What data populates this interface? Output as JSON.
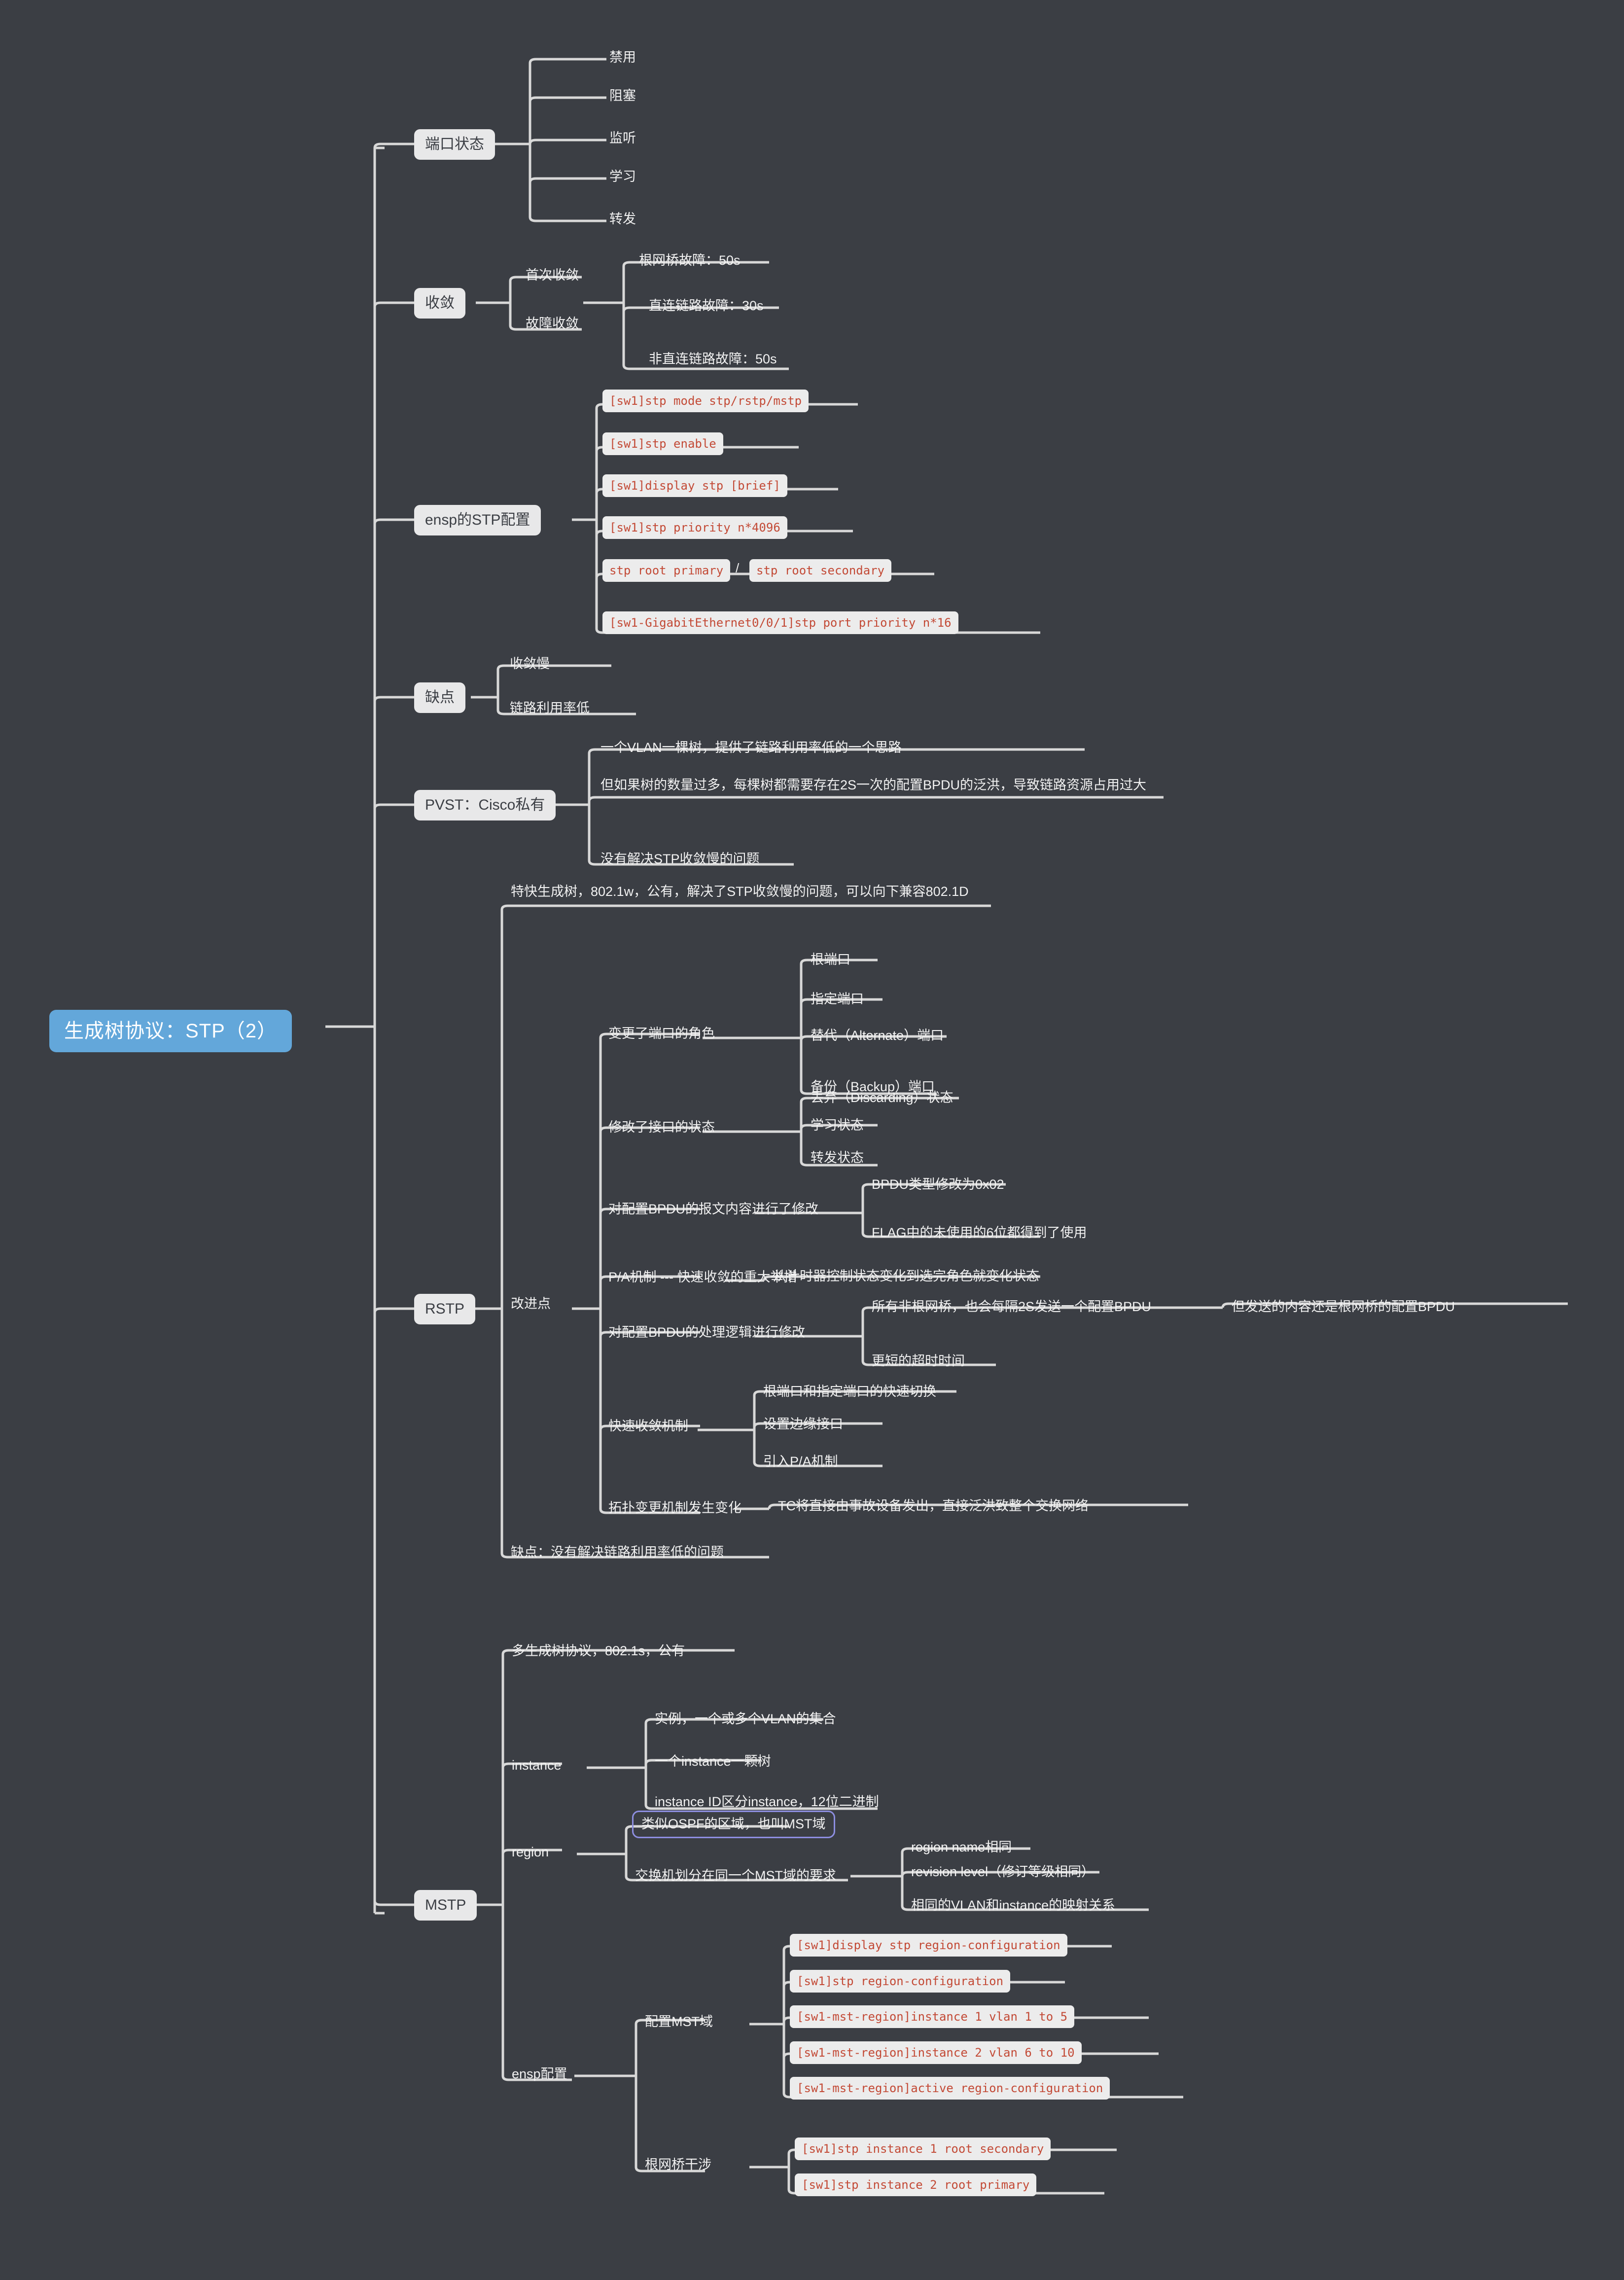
{
  "theme": {
    "background": "#3b3e44",
    "root_fill": "#63a7da",
    "root_text": "#ffffff",
    "chip_fill": "#e8e8e9",
    "chip_text": "#3b3e44",
    "text_color": "#f2f2f2",
    "code_fill": "#ececec",
    "code_text": "#c34a36",
    "outline_color": "#8d8ee0",
    "wire_color": "#d8d8d8"
  },
  "root": {
    "label": "生成树协议：STP（2）"
  },
  "branches": {
    "port_state": {
      "label": "端口状态",
      "children": [
        {
          "label": "禁用"
        },
        {
          "label": "阻塞"
        },
        {
          "label": "监听"
        },
        {
          "label": "学习"
        },
        {
          "label": "转发"
        }
      ]
    },
    "convergence": {
      "label": "收敛",
      "children": [
        {
          "label": "首次收敛"
        },
        {
          "label": "故障收敛",
          "children": [
            {
              "label": "根网桥故障：50s"
            },
            {
              "label": "直连链路故障：30s"
            },
            {
              "label": "非直连链路故障：50s"
            }
          ]
        }
      ]
    },
    "ensp_stp_config": {
      "label": "ensp的STP配置",
      "children": [
        {
          "label": "[sw1]stp mode stp/rstp/mstp"
        },
        {
          "label": "[sw1]stp enable"
        },
        {
          "label": "[sw1]display stp [brief]"
        },
        {
          "label": "[sw1]stp priority n*4096"
        },
        {
          "label": "stp root primary",
          "separator": "/",
          "label2": "stp root secondary"
        },
        {
          "label": "[sw1-GigabitEthernet0/0/1]stp port priority n*16"
        }
      ]
    },
    "drawbacks": {
      "label": "缺点",
      "children": [
        {
          "label": "收敛慢"
        },
        {
          "label": "链路利用率低"
        }
      ]
    },
    "pvst": {
      "label": "PVST：Cisco私有",
      "children": [
        {
          "label": "一个VLAN一棵树，提供了链路利用率低的一个思路"
        },
        {
          "label": "但如果树的数量过多，每棵树都需要存在2S一次的配置BPDU的泛洪，导致链路资源占用过大"
        },
        {
          "label": "没有解决STP收敛慢的问题"
        }
      ]
    },
    "rstp": {
      "label": "RSTP",
      "intro": "特快生成树，802.1w，公有，解决了STP收敛慢的问题，可以向下兼容802.1D",
      "improvements_label": "改进点",
      "improvements": [
        {
          "label": "变更了端口的角色",
          "children": [
            {
              "label": "根端口"
            },
            {
              "label": "指定端口"
            },
            {
              "label": "替代（Alternate）端口"
            },
            {
              "label": "备份（Backup）端口"
            }
          ]
        },
        {
          "label": "修改了接口的状态",
          "children": [
            {
              "label": "丢弃（Discarding）状态"
            },
            {
              "label": "学习状态"
            },
            {
              "label": "转发状态"
            }
          ]
        },
        {
          "label": "对配置BPDU的报文内容进行了修改",
          "children": [
            {
              "label": "BPDU类型修改为0x02"
            },
            {
              "label": "FLAG中的未使用的6位都得到了使用"
            }
          ]
        },
        {
          "label": "P/A机制 --- 快速收敛的重大举措",
          "children": [
            {
              "label": "从计时器控制状态变化到选完角色就变化状态"
            }
          ]
        },
        {
          "label": "对配置BPDU的处理逻辑进行修改",
          "children": [
            {
              "label": "所有非根网桥，也会每隔2S发送一个配置BPDU",
              "note": "但发送的内容还是根网桥的配置BPDU"
            },
            {
              "label": "更短的超时时间"
            }
          ]
        },
        {
          "label": "快速收敛机制",
          "children": [
            {
              "label": "根端口和指定端口的快速切换"
            },
            {
              "label": "设置边缘接口"
            },
            {
              "label": "引入P/A机制"
            }
          ]
        },
        {
          "label": "拓扑变更机制发生变化",
          "children": [
            {
              "label": "TC将直接由事故设备发出，直接泛洪致整个交换网络"
            }
          ]
        }
      ],
      "drawback": "缺点：没有解决链路利用率低的问题"
    },
    "mstp": {
      "label": "MSTP",
      "intro": "多生成树协议，802.1s，公有",
      "children": [
        {
          "label": "instance",
          "children": [
            {
              "label": "实例，一个或多个VLAN的集合"
            },
            {
              "label": "一个instance一颗树"
            },
            {
              "label": "instance ID区分instance，12位二进制"
            }
          ]
        },
        {
          "label": "region",
          "children": [
            {
              "label": "类似OSPF的区域，也叫MST域",
              "highlighted": true
            },
            {
              "label": "交换机划分在同一个MST域的要求",
              "children": [
                {
                  "label": "region name相同"
                },
                {
                  "label": "revision level（修订等级相同）"
                },
                {
                  "label": "相同的VLAN和instance的映射关系"
                }
              ]
            }
          ]
        },
        {
          "label": "ensp配置",
          "children": [
            {
              "label": "配置MST域",
              "children": [
                {
                  "label": "[sw1]display stp region-configuration"
                },
                {
                  "label": "[sw1]stp region-configuration"
                },
                {
                  "label": "[sw1-mst-region]instance 1 vlan 1 to 5"
                },
                {
                  "label": "[sw1-mst-region]instance 2 vlan 6 to 10"
                },
                {
                  "label": "[sw1-mst-region]active region-configuration"
                }
              ]
            },
            {
              "label": "根网桥干涉",
              "children": [
                {
                  "label": "[sw1]stp instance 1 root secondary"
                },
                {
                  "label": "[sw1]stp instance 2 root primary"
                }
              ]
            }
          ]
        }
      ]
    }
  }
}
